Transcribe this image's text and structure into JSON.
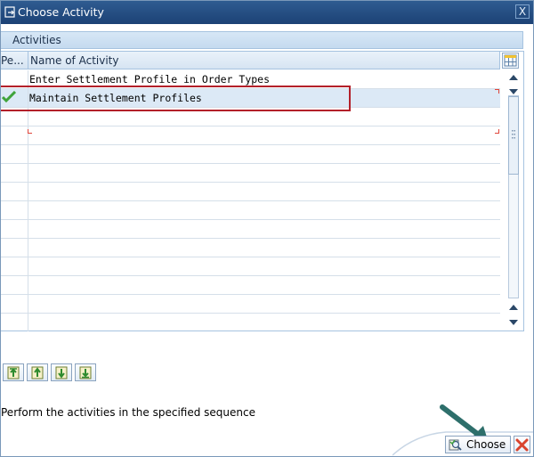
{
  "window": {
    "title": "Choose Activity",
    "close_glyph": "X"
  },
  "panel": {
    "title": "Activities"
  },
  "table": {
    "headers": [
      "Pe...",
      "Name of Activity"
    ],
    "rows": [
      {
        "status": "",
        "name": "Enter Settlement Profile in Order Types"
      },
      {
        "status": "checkmark-icon",
        "name": "Maintain Settlement Profiles"
      }
    ],
    "visible_row_count": 14
  },
  "toolbar": {
    "buttons": [
      "move-first-icon",
      "move-up-icon",
      "move-down-icon",
      "move-last-icon"
    ]
  },
  "status": {
    "text": "Perform the activities in the specified sequence"
  },
  "footer": {
    "choose_label": "Choose"
  },
  "colors": {
    "titlebar": "#1c4275",
    "highlight": "#b3202a",
    "checkmark": "#3fa33a",
    "cancel": "#d9442e",
    "annotation_arrow": "#2e6f6b"
  }
}
